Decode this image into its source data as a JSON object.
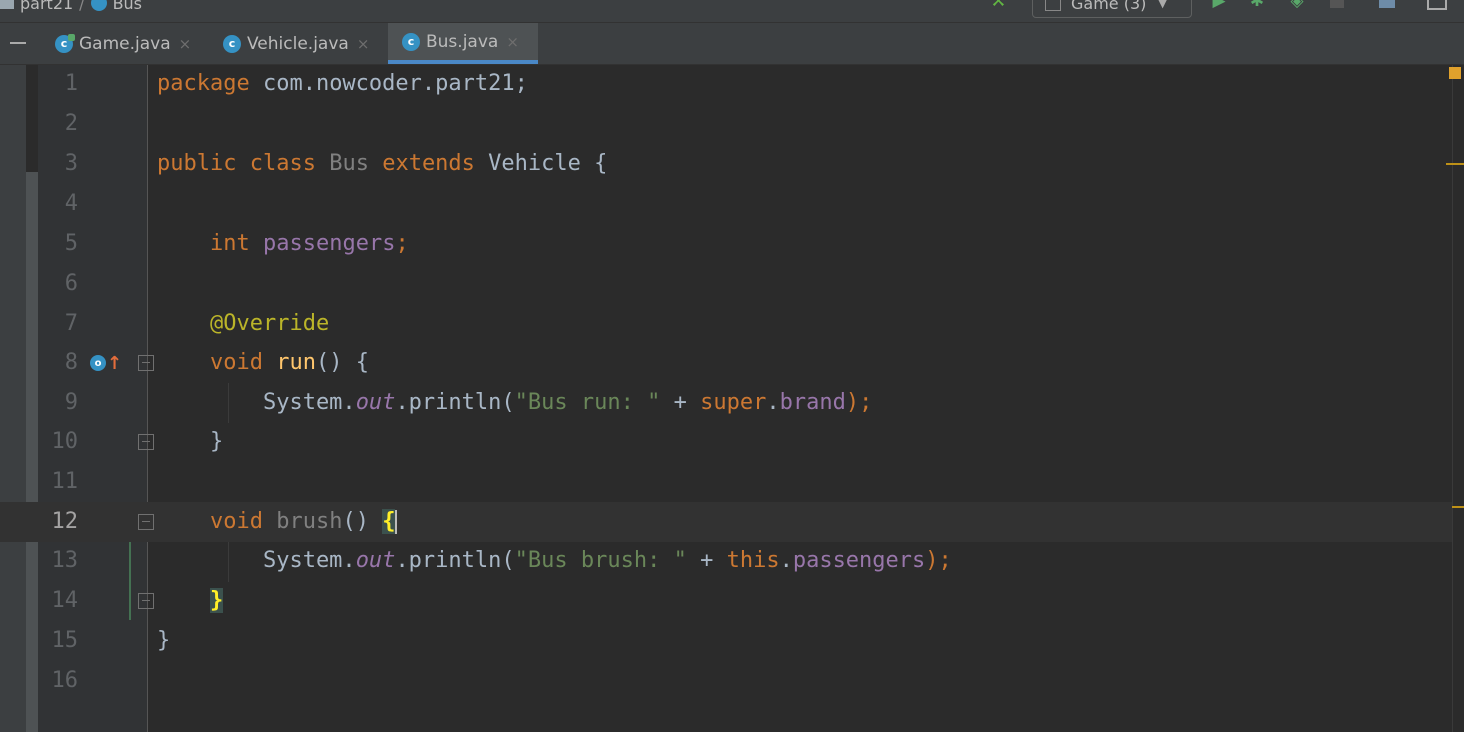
{
  "breadcrumb": {
    "project": "part21",
    "separator": "/",
    "file": "Bus"
  },
  "toolbar": {
    "run_config": "Game (3)"
  },
  "tabs": [
    {
      "label": "Game.java",
      "icon": "runnable-class-icon",
      "active": false
    },
    {
      "label": "Vehicle.java",
      "icon": "class-icon",
      "active": false
    },
    {
      "label": "Bus.java",
      "icon": "class-icon",
      "active": true
    }
  ],
  "editor": {
    "current_line": 12,
    "line_numbers": [
      "1",
      "2",
      "3",
      "4",
      "5",
      "6",
      "7",
      "8",
      "9",
      "10",
      "11",
      "12",
      "13",
      "14",
      "15",
      "16"
    ],
    "lines": [
      "package com.nowcoder.part21;",
      "",
      "public class Bus extends Vehicle {",
      "",
      "    int passengers;",
      "",
      "    @Override",
      "    void run() {",
      "        System.out.println(\"Bus run: \" + super.brand);",
      "    }",
      "",
      "    void brush() {",
      "        System.out.println(\"Bus brush: \" + this.passengers);",
      "    }",
      "}",
      ""
    ]
  },
  "colors": {
    "keyword": "#cc7832",
    "string": "#6a8759",
    "field": "#9876aa",
    "annotation": "#bbb529",
    "method_decl": "#ffc66d",
    "background": "#2b2b2b"
  }
}
